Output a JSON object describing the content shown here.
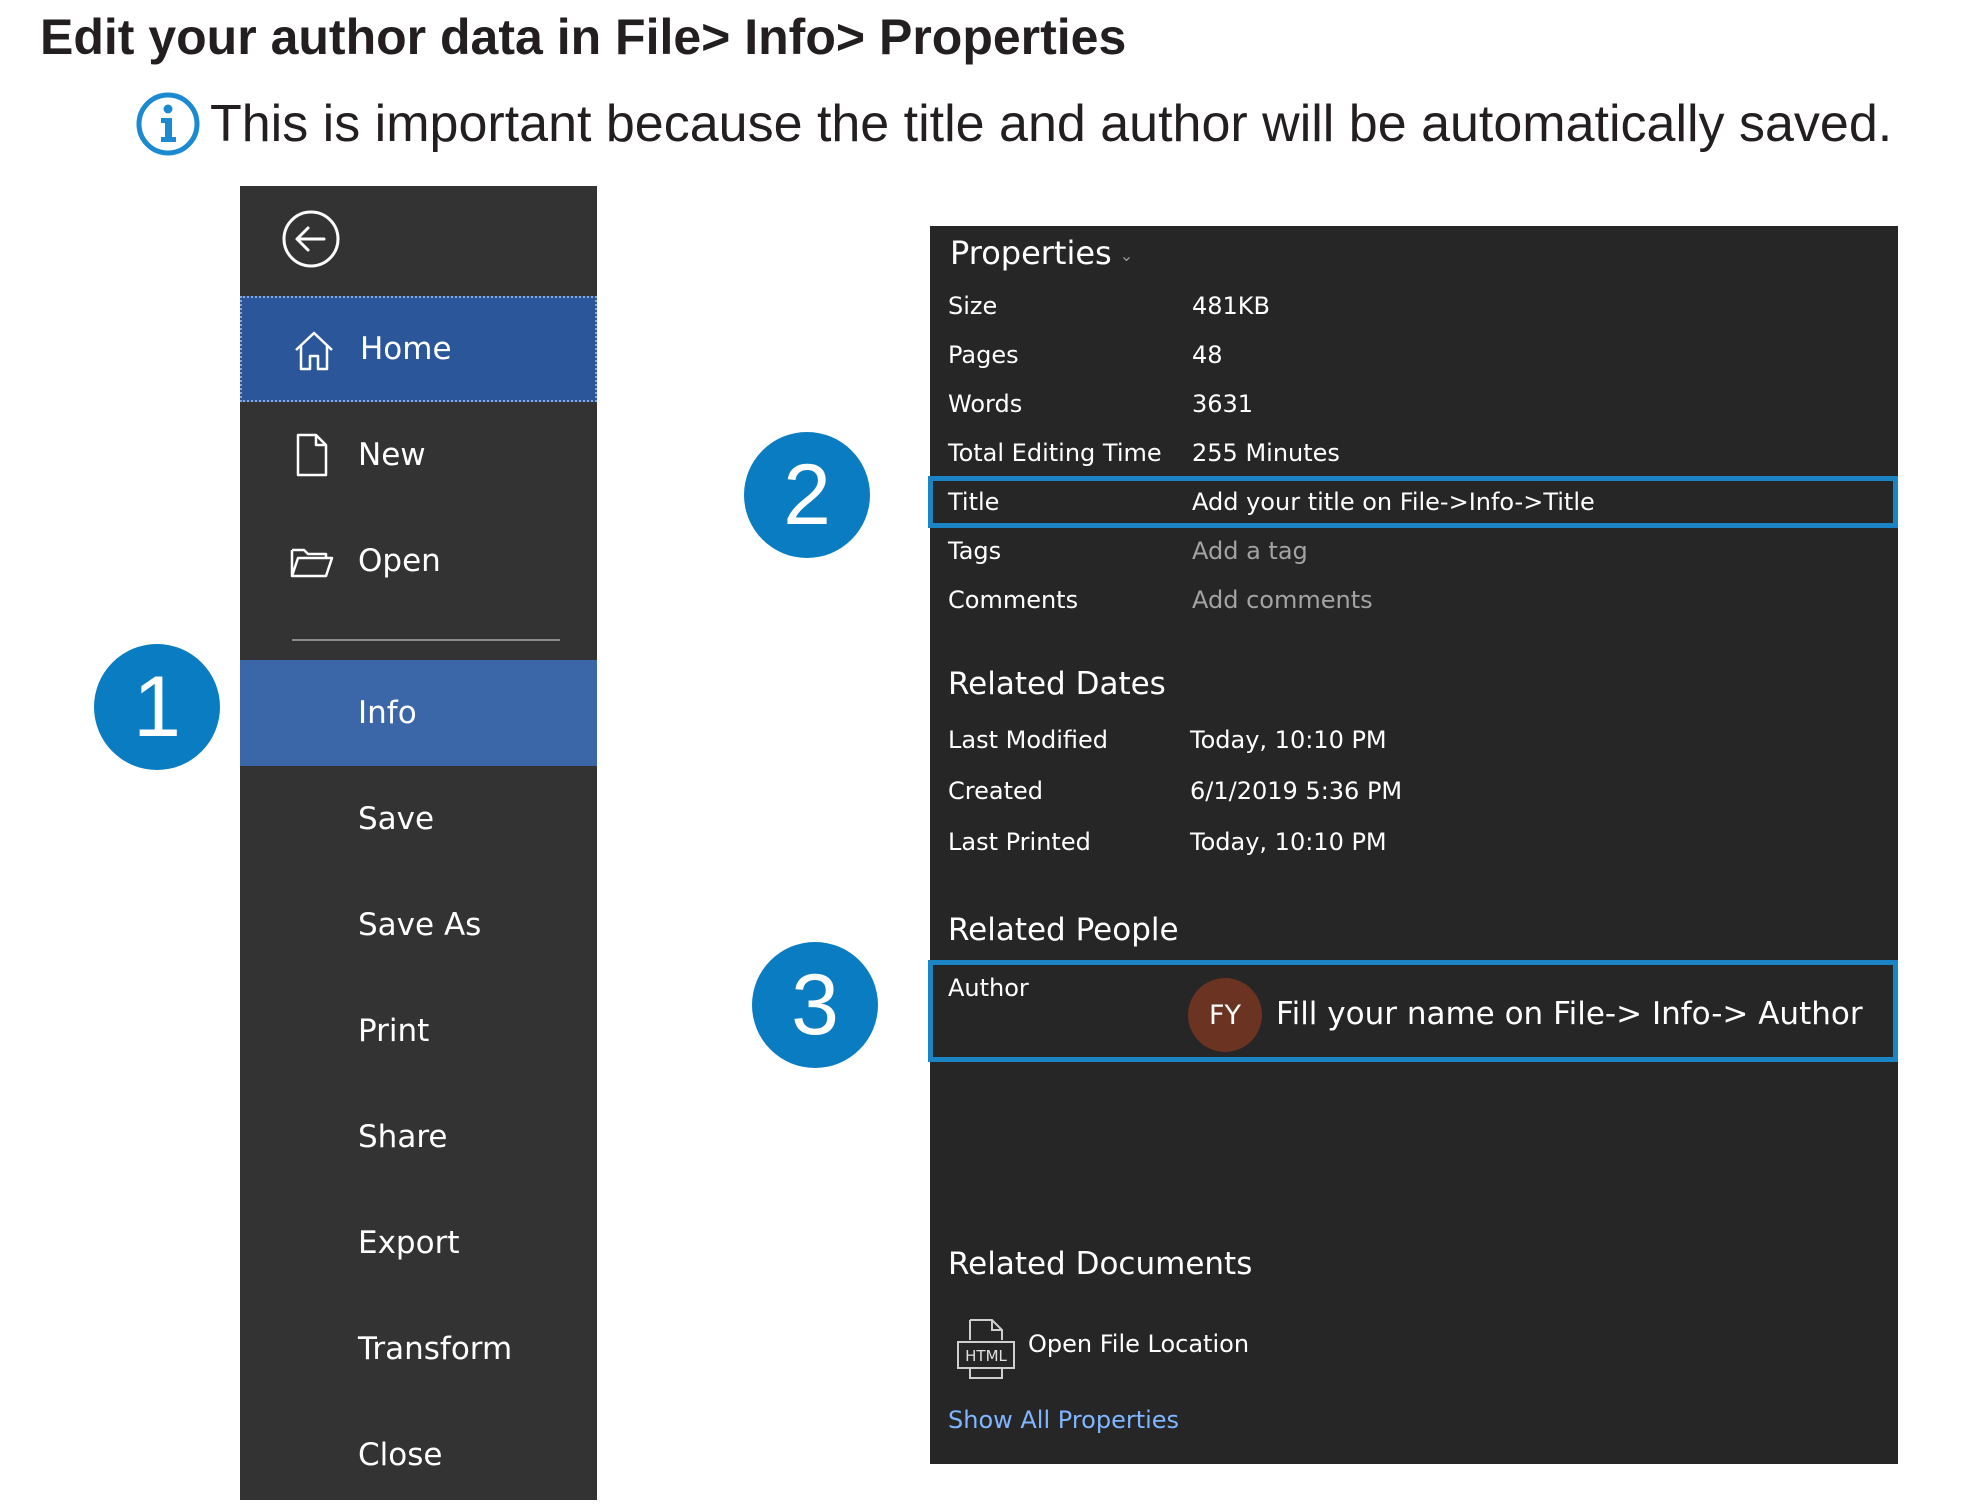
{
  "heading": "Edit your author data in File> Info> Properties",
  "note": {
    "icon": "info-icon",
    "text": "This is important because  the title and author will be automatically saved."
  },
  "nav": {
    "back_icon": "back-arrow-icon",
    "items": [
      {
        "label": "Home",
        "icon": "home-icon",
        "state": "selected"
      },
      {
        "label": "New",
        "icon": "new-document-icon"
      },
      {
        "label": "Open",
        "icon": "open-folder-icon"
      },
      {
        "label": "Info",
        "state": "active"
      },
      {
        "label": "Save"
      },
      {
        "label": "Save As"
      },
      {
        "label": "Print"
      },
      {
        "label": "Share"
      },
      {
        "label": "Export"
      },
      {
        "label": "Transform"
      },
      {
        "label": "Close"
      }
    ]
  },
  "badges": [
    "1",
    "2",
    "3"
  ],
  "properties": {
    "title": "Properties",
    "rows": [
      {
        "label": "Size",
        "value": "481KB"
      },
      {
        "label": "Pages",
        "value": "48"
      },
      {
        "label": "Words",
        "value": "3631"
      },
      {
        "label": "Total Editing Time",
        "value": "255 Minutes"
      },
      {
        "label": "Title",
        "value": "Add your title on File->Info->Title"
      },
      {
        "label": "Tags",
        "value": "Add a tag"
      },
      {
        "label": "Comments",
        "value": "Add comments"
      }
    ]
  },
  "related_dates": {
    "title": "Related Dates",
    "rows": [
      {
        "label": "Last Modified",
        "value": "Today, 10:10 PM"
      },
      {
        "label": "Created",
        "value": "6/1/2019 5:36 PM"
      },
      {
        "label": "Last Printed",
        "value": "Today, 10:10 PM"
      }
    ]
  },
  "related_people": {
    "title": "Related People",
    "author_label": "Author",
    "avatar_initials": "FY",
    "author_value": "Fill your name on File-> Info-> Author"
  },
  "related_documents": {
    "title": "Related Documents",
    "file_icon_text": "HTML",
    "open_location": "Open File Location"
  },
  "show_all": "Show All Properties",
  "colors": {
    "nav_bg": "#333333",
    "panel_bg": "#262626",
    "selected_nav": "#2b579a",
    "active_nav": "#3b66a8",
    "badge": "#0a7dc2",
    "highlight_border": "#1b84c4",
    "link": "#7fb6ff",
    "avatar": "#6b3321"
  }
}
